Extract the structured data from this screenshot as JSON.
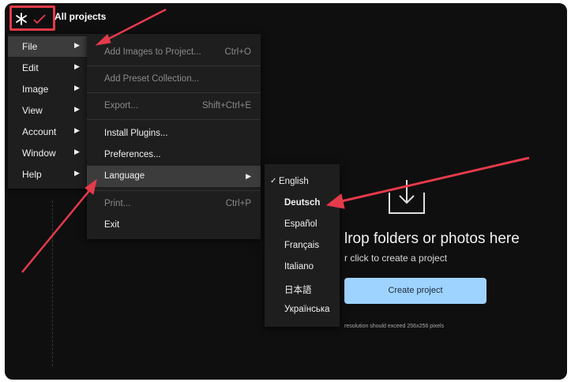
{
  "app": {
    "title": "All projects"
  },
  "menubar": {
    "items": [
      {
        "label": "File",
        "arrow": "▶"
      },
      {
        "label": "Edit",
        "arrow": "▶"
      },
      {
        "label": "Image",
        "arrow": "▶"
      },
      {
        "label": "View",
        "arrow": "▶"
      },
      {
        "label": "Account",
        "arrow": "▶"
      },
      {
        "label": "Window",
        "arrow": "▶"
      },
      {
        "label": "Help",
        "arrow": "▶"
      }
    ]
  },
  "file_menu": {
    "items": [
      {
        "label": "Add Images to Project...",
        "shortcut": "Ctrl+O"
      },
      {
        "label": "Add Preset Collection..."
      },
      {
        "label": "Export...",
        "shortcut": "Shift+Ctrl+E"
      },
      {
        "label": "Install Plugins..."
      },
      {
        "label": "Preferences..."
      },
      {
        "label": "Language",
        "arrow": "▶"
      },
      {
        "label": "Print...",
        "shortcut": "Ctrl+P"
      },
      {
        "label": "Exit"
      }
    ]
  },
  "language_menu": {
    "check": "✓",
    "items": [
      {
        "label": "English"
      },
      {
        "label": "Deutsch"
      },
      {
        "label": "Español"
      },
      {
        "label": "Français"
      },
      {
        "label": "Italiano"
      },
      {
        "label": "日本語"
      },
      {
        "label": "Українська"
      }
    ]
  },
  "drop_zone": {
    "title": "lrop folders or photos here",
    "subtitle": "r click to create a project",
    "button": "Create project",
    "hint": "resolution should exceed 256x256 pixels"
  },
  "colors": {
    "background": "#0f0f0f",
    "menu": "#1e1e1e",
    "highlight": "#3c3c3c",
    "accent_button": "#9fd3ff",
    "annotation": "#e53a4a"
  }
}
